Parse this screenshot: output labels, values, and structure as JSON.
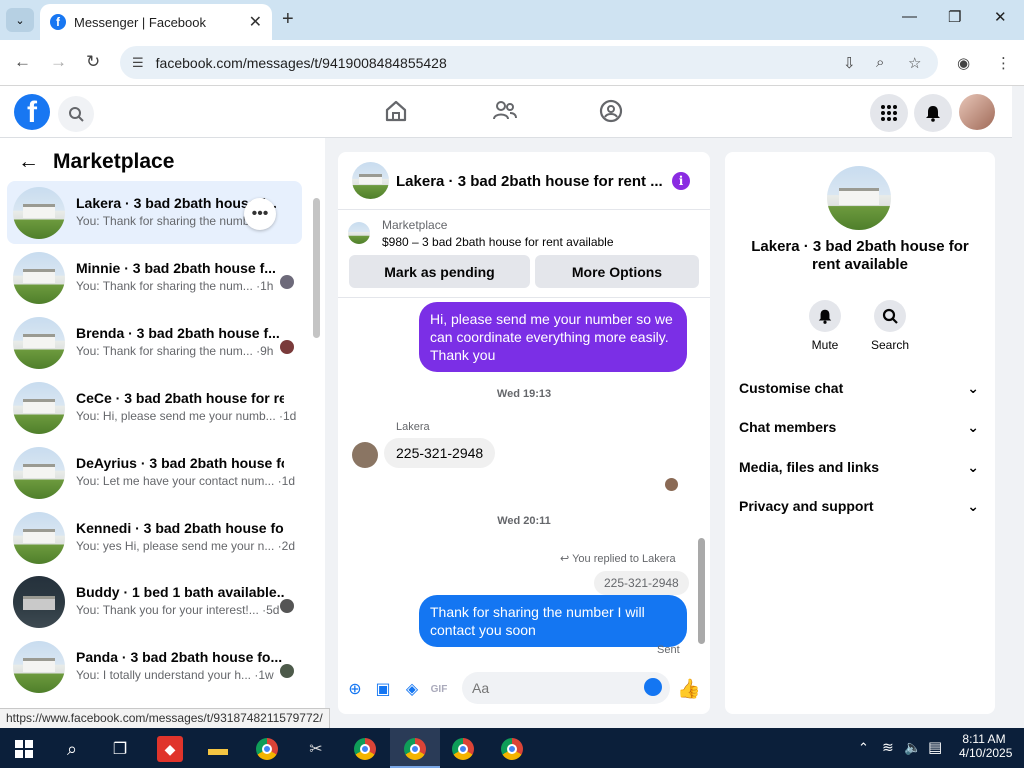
{
  "browser": {
    "tab_title": "Messenger | Facebook",
    "url": "facebook.com/messages/t/9419008484855428",
    "status_url": "https://www.facebook.com/messages/t/9318748211579772/"
  },
  "left": {
    "title": "Marketplace",
    "conversations": [
      {
        "name": "Lakera · 3 bad 2bath house f...",
        "preview": "You: Thank for sharing the numbe",
        "time": "m"
      },
      {
        "name": "Minnie · 3 bad 2bath house f...",
        "preview": "You: Thank for sharing the num... ·1h",
        "time": ""
      },
      {
        "name": "Brenda · 3 bad 2bath house f...",
        "preview": "You: Thank for sharing the num... ·9h",
        "time": ""
      },
      {
        "name": "CeCe · 3 bad 2bath house for re...",
        "preview": "You: Hi, please send me your numb... ·1d",
        "time": ""
      },
      {
        "name": "DeAyrius · 3 bad 2bath house fo...",
        "preview": "You: Let me have your contact num... ·1d",
        "time": ""
      },
      {
        "name": "Kennedi · 3 bad 2bath house for...",
        "preview": "You: yes Hi, please send me your n... ·2d",
        "time": ""
      },
      {
        "name": "Buddy · 1 bed 1 bath available...",
        "preview": "You: Thank you for your interest!... ·5d",
        "time": ""
      },
      {
        "name": "Panda · 3 bad 2bath house fo...",
        "preview": "You: I totally understand your h... ·1w",
        "time": ""
      }
    ]
  },
  "chat": {
    "header_name": "Lakera · 3 bad 2bath house for rent ...",
    "marketplace_label": "Marketplace",
    "listing": "$980 – 3 bad 2bath house for rent available",
    "btn_pending": "Mark as pending",
    "btn_more": "More Options",
    "msg1": "Hi, please send me your number so we can coordinate everything more easily. Thank you",
    "time1": "Wed 19:13",
    "sender": "Lakera",
    "msg2": "225-321-2948",
    "time2": "Wed 20:11",
    "replied": "You replied to Lakera",
    "quoted": "225-321-2948",
    "msg3": "Thank for sharing  the number I will contact you soon",
    "sent": "Sent",
    "input_placeholder": "Aa"
  },
  "right": {
    "name": "Lakera · 3 bad 2bath house for rent available",
    "mute": "Mute",
    "search": "Search",
    "rows": [
      "Customise chat",
      "Chat members",
      "Media, files and links",
      "Privacy and support"
    ]
  },
  "taskbar": {
    "time": "8:11 AM",
    "date": "4/10/2025"
  },
  "colors": {
    "accent_blue": "#1476f2",
    "accent_purple": "#7b2fe6"
  }
}
